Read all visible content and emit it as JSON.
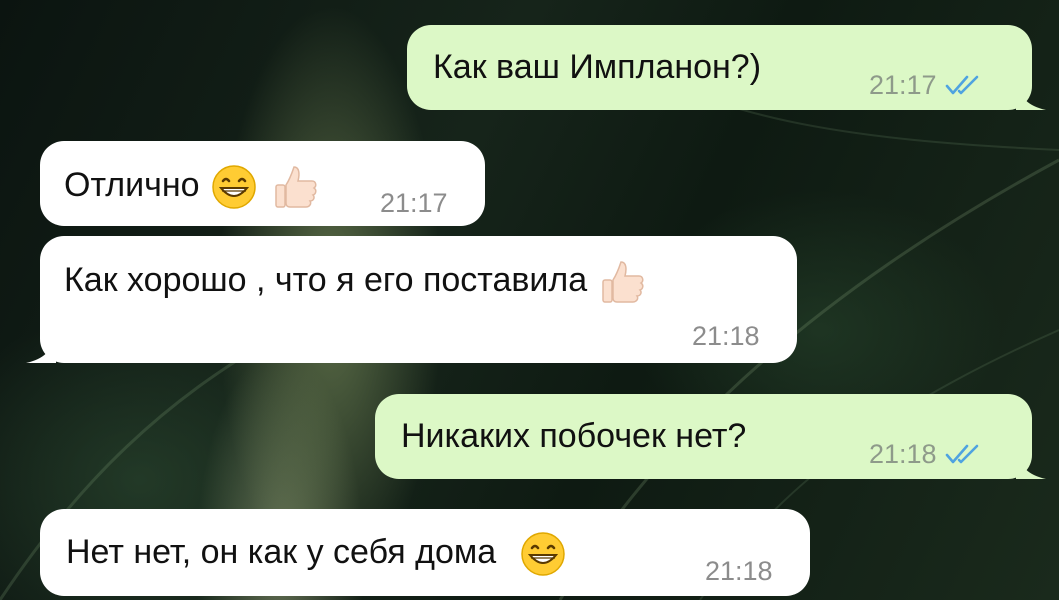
{
  "messages": [
    {
      "direction": "outgoing",
      "text": "Как ваш Импланон?)",
      "time": "21:17",
      "status": "read-double-check-icon"
    },
    {
      "direction": "incoming",
      "text": "Отлично",
      "emoji": [
        "grinning-face-icon",
        "thumbs-up-icon"
      ],
      "time": "21:17"
    },
    {
      "direction": "incoming",
      "text": "Как хорошо , что я его поставила",
      "emoji": [
        "thumbs-up-icon"
      ],
      "time": "21:18"
    },
    {
      "direction": "outgoing",
      "text": "Никаких побочек нет?",
      "time": "21:18",
      "status": "read-double-check-icon"
    },
    {
      "direction": "incoming",
      "text": "Нет нет, он как у себя дома",
      "emoji": [
        "grinning-face-icon"
      ],
      "time": "21:18"
    }
  ],
  "colors": {
    "outgoing_bubble": "#dcf8c6",
    "incoming_bubble": "#ffffff",
    "read_check": "#4fa3e0"
  }
}
